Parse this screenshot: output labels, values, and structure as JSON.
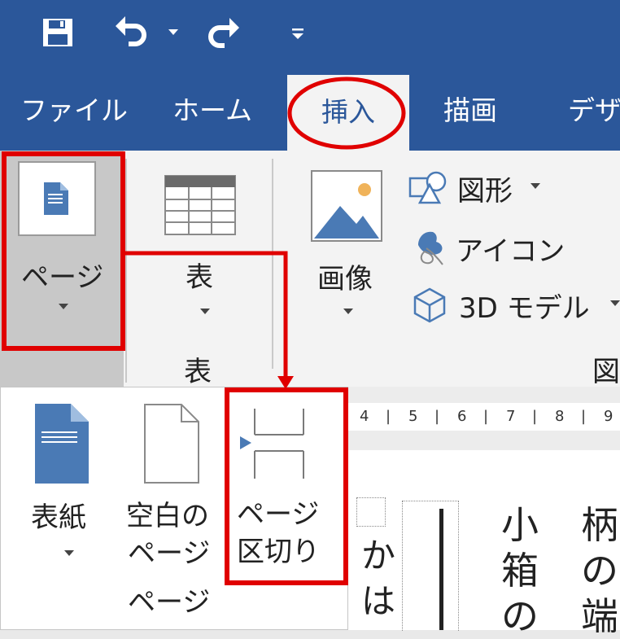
{
  "quick_access": {
    "save_icon": "save-icon",
    "undo_icon": "undo-icon",
    "redo_icon": "redo-icon",
    "customize_icon": "customize-quick-access-icon"
  },
  "tabs": [
    "ファイル",
    "ホーム",
    "挿入",
    "描画",
    "デザ"
  ],
  "ribbon": {
    "page_button": "ページ",
    "table_button": "表",
    "table_group": "表",
    "image_button": "画像",
    "shapes": "図形",
    "icons": "アイコン",
    "models3d": "3D モデル",
    "illustrations_group_partial": "図"
  },
  "page_menu": {
    "cover": "表紙",
    "blank_line1": "空白の",
    "blank_line2": "ページ",
    "break_line1": "ページ",
    "break_line2": "区切り",
    "group_label": "ページ"
  },
  "ruler": [
    "4",
    "5",
    "6",
    "7",
    "8",
    "9"
  ],
  "document_text": {
    "col1": [
      "か",
      "は"
    ],
    "col2": [
      "小",
      "箱",
      "の"
    ],
    "col3": [
      "柄",
      "の",
      "端"
    ]
  },
  "colors": {
    "ribbon_blue": "#2b579a",
    "highlight_red": "#e00000",
    "icon_blue": "#4a7ab5"
  }
}
